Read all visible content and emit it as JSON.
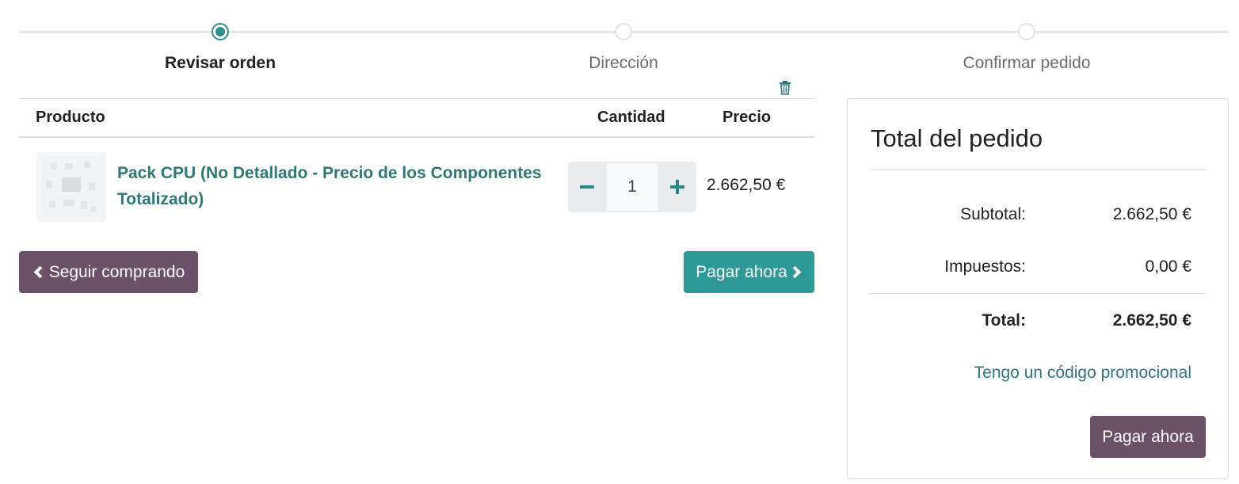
{
  "steps": [
    {
      "label": "Revisar orden",
      "active": true
    },
    {
      "label": "Dirección",
      "active": false
    },
    {
      "label": "Confirmar pedido",
      "active": false
    }
  ],
  "cart": {
    "headers": {
      "product": "Producto",
      "quantity": "Cantidad",
      "price": "Precio"
    },
    "items": [
      {
        "name": "Pack CPU (No Detallado - Precio de los Componentes Totalizado)",
        "quantity": "1",
        "price": "2.662,50 €",
        "image_icon": "product-placeholder-icon"
      }
    ]
  },
  "buttons": {
    "continue_shopping": "Seguir comprando",
    "pay_now": "Pagar ahora"
  },
  "summary": {
    "title": "Total del pedido",
    "subtotal_label": "Subtotal:",
    "subtotal_value": "2.662,50 €",
    "taxes_label": "Impuestos:",
    "taxes_value": "0,00 €",
    "total_label": "Total:",
    "total_value": "2.662,50 €",
    "promo_link": "Tengo un código promocional",
    "pay_now": "Pagar ahora"
  },
  "colors": {
    "accent_teal": "#2e9a98",
    "link_teal": "#2b7a78",
    "secondary_purple": "#6b5266"
  }
}
